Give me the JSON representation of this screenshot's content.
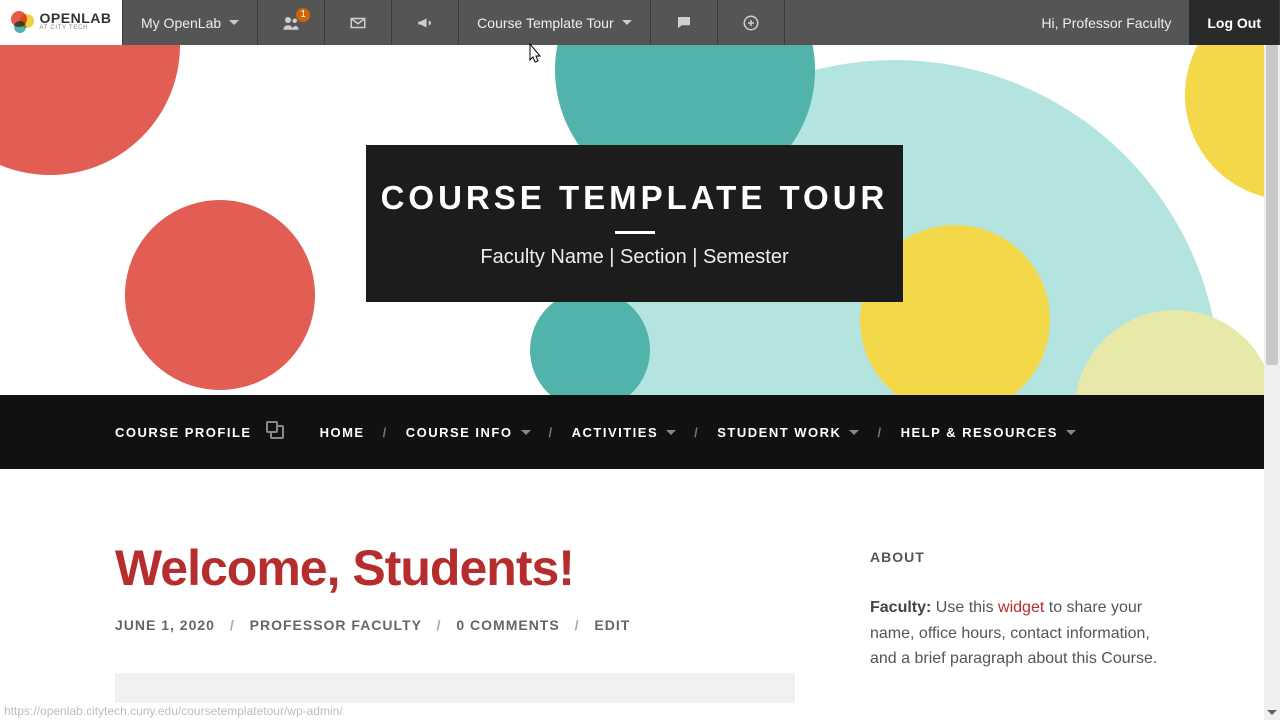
{
  "brand": {
    "name": "OPENLAB",
    "sub": "AT CITY TECH"
  },
  "adminbar": {
    "my_openlab": "My OpenLab",
    "friends_badge": "1",
    "course": "Course Template Tour",
    "greeting": "Hi, Professor Faculty",
    "logout": "Log Out"
  },
  "hero": {
    "title": "COURSE TEMPLATE TOUR",
    "subtitle": "Faculty Name | Section | Semester"
  },
  "nav": {
    "profile": "COURSE PROFILE",
    "home": "HOME",
    "info": "COURSE INFO",
    "activities": "ACTIVITIES",
    "student_work": "STUDENT WORK",
    "help": "HELP & RESOURCES"
  },
  "post": {
    "title": "Welcome, Students!",
    "date": "JUNE 1, 2020",
    "author": "PROFESSOR FACULTY",
    "comments": "0 COMMENTS",
    "edit": "EDIT"
  },
  "sidebar": {
    "about_title": "ABOUT",
    "faculty_label": "Faculty:",
    "about_pre": "Use this ",
    "about_link": "widget",
    "about_post": " to share your name, office hours, contact information, and a brief paragraph about this Course."
  },
  "status_url": "https://openlab.citytech.cuny.edu/coursetemplatetour/wp-admin/"
}
